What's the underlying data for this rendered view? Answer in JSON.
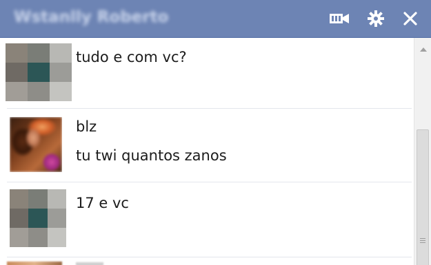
{
  "titlebar": {
    "contact_name": "Wstanlly Roberto",
    "bg_color": "#6d84b4",
    "icons": [
      "video-camera-icon",
      "gear-icon",
      "close-icon"
    ]
  },
  "messages": [
    {
      "avatar": "pixelated-avatar",
      "lines": [
        "tudo e com vc?"
      ]
    },
    {
      "avatar": "photo-avatar",
      "lines": [
        "blz",
        "tu twi quantos zanos"
      ]
    },
    {
      "avatar": "pixelated-avatar",
      "lines": [
        "17 e vc"
      ]
    }
  ]
}
